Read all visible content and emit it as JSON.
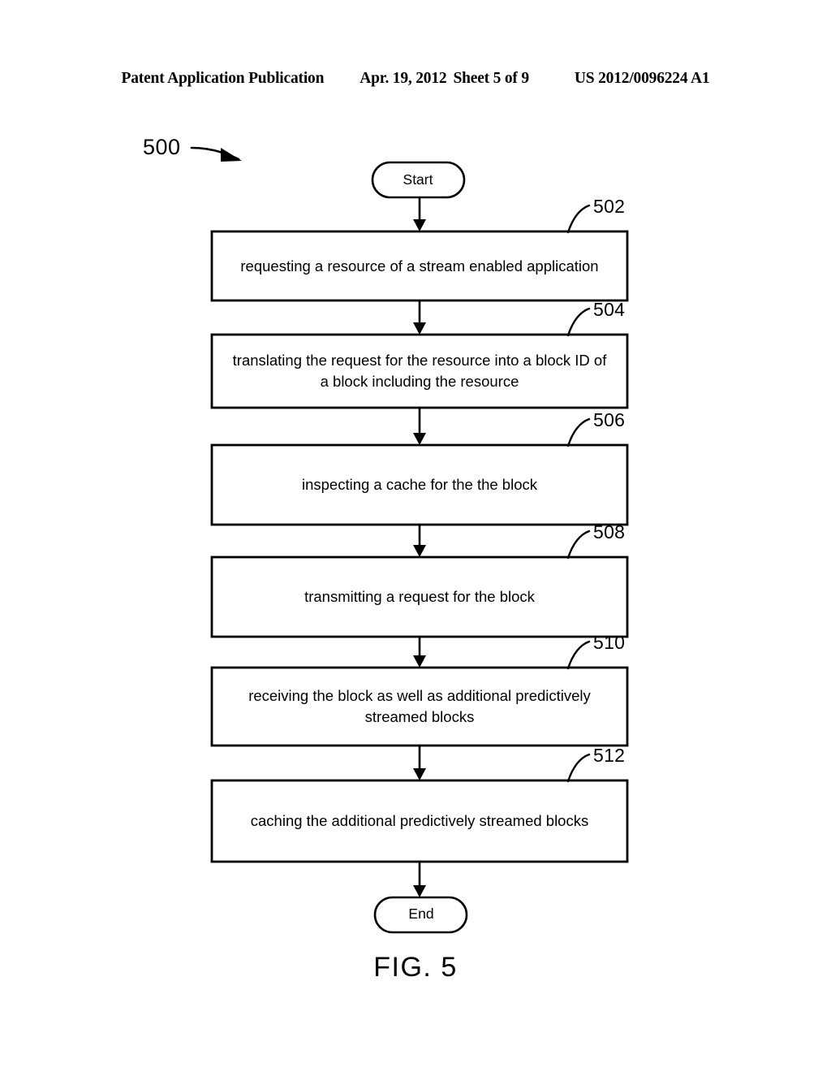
{
  "header": {
    "publication": "Patent Application Publication",
    "date": "Apr. 19, 2012",
    "sheet": "Sheet 5 of 9",
    "patent_number": "US 2012/0096224 A1"
  },
  "figure": {
    "caption": "FIG. 5",
    "callout": "500",
    "start_label": "Start",
    "end_label": "End",
    "line_color": "#000000",
    "fill_color": "#ffffff",
    "steps": [
      {
        "ref": "502",
        "text": "requesting a resource of a stream enabled application"
      },
      {
        "ref": "504",
        "text": "translating the request for the resource into a block ID of a block including the resource"
      },
      {
        "ref": "506",
        "text": "inspecting a cache for the the block"
      },
      {
        "ref": "508",
        "text": "transmitting a request for the block"
      },
      {
        "ref": "510",
        "text": "receiving the block as well as additional predictively streamed blocks"
      },
      {
        "ref": "512",
        "text": "caching the additional predictively streamed blocks"
      }
    ]
  }
}
